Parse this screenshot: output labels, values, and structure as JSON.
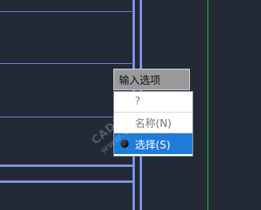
{
  "dynamic_input": {
    "prompt": "输入选项",
    "options": [
      {
        "label": "?"
      },
      {
        "label": "名称(N)"
      },
      {
        "label": "选择(S)"
      }
    ]
  },
  "watermark": {
    "line1": "CAD自学网",
    "line2": "www.cadzxw.com"
  },
  "colors": {
    "background": "#232a35",
    "thin_line": "#6f86d8",
    "thick_line": "#7f95ea",
    "green_line": "#27c33d",
    "selection": "#1e7bd8"
  }
}
